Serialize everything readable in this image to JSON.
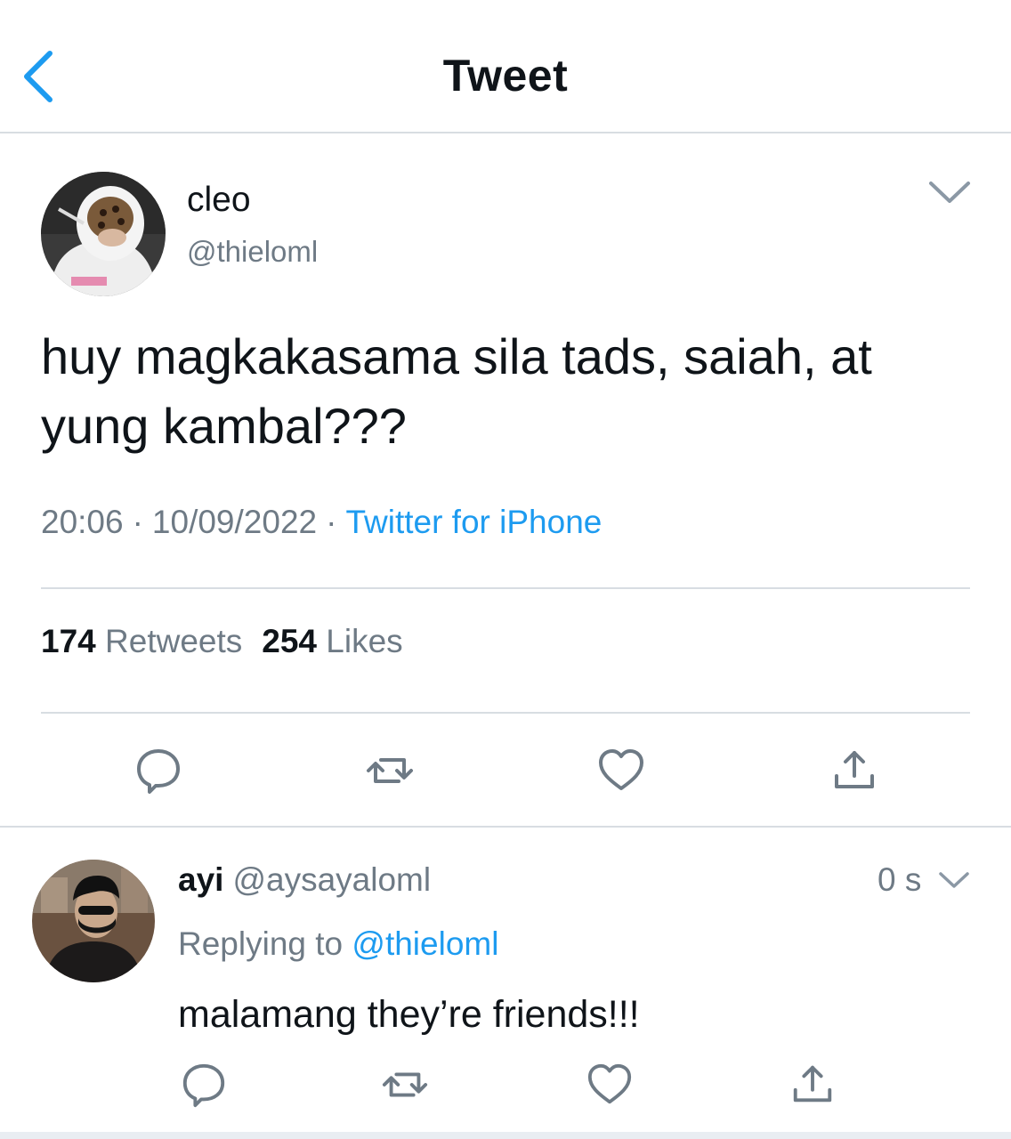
{
  "nav": {
    "title": "Tweet",
    "back_icon": "chevron-left-icon"
  },
  "tweet": {
    "author_name": "cleo",
    "author_handle": "@thieloml",
    "text": "huy magkakasama sila tads, saiah, at yung kambal???",
    "time": "20:06",
    "date": "10/09/2022",
    "source": "Twitter for iPhone",
    "retweet_count": "174",
    "retweet_label": "Retweets",
    "like_count": "254",
    "like_label": "Likes"
  },
  "reply": {
    "author_name": "ayi",
    "author_handle": "@aysayaloml",
    "time": "0 s",
    "replying_prefix": "Replying to",
    "replying_to": "@thieloml",
    "text": "malamang they’re friends!!!"
  },
  "colors": {
    "accent": "#1d9bf0",
    "secondary_text": "#6e7a85",
    "divider": "#d8dde2",
    "icon": "#6e7a85"
  }
}
